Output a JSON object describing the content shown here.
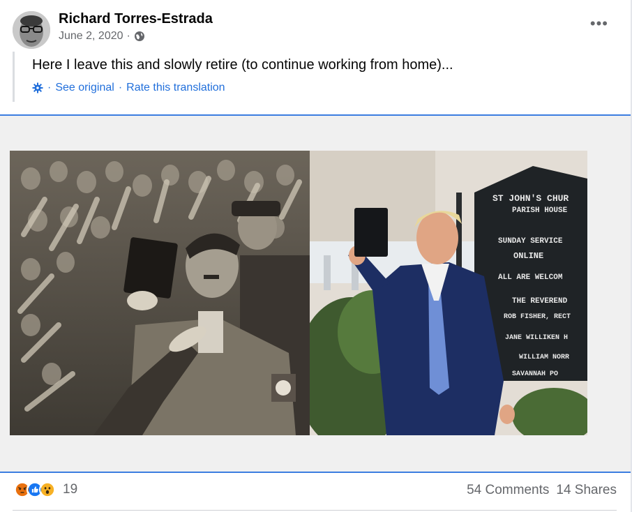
{
  "post": {
    "author": "Richard Torres-Estrada",
    "date": "June 2, 2020",
    "date_separator": "·",
    "privacy_icon": "globe-icon",
    "more_label": "•••",
    "text": "Here I leave this and slowly retire (to continue working from home)...",
    "translation": {
      "icon": "gear-icon",
      "separator": "·",
      "see_original": "See original",
      "rate": "Rate this translation"
    }
  },
  "media": {
    "left_image": "bw-crowd-salute-photo",
    "right_image": "color-photo-man-holding-book",
    "sign_lines": [
      "ST JOHN'S CHUR",
      "PARISH HOUSE",
      "SUNDAY SERVICE",
      "ONLINE",
      "ALL ARE WELCOM",
      "THE REVEREND",
      "ROB FISHER, RECT",
      "JANE WILLIKEN H",
      "WILLIAM NORR",
      "SAVANNAH PO"
    ]
  },
  "footer": {
    "reaction_icons": [
      "angry-icon",
      "like-icon",
      "wow-icon"
    ],
    "reaction_count": "19",
    "comments": "54 Comments",
    "shares": "14 Shares"
  },
  "colors": {
    "link": "#216fdb",
    "secondary": "#65676b",
    "media_border": "#3b7de0",
    "angry": "#e9710f",
    "like": "#1877f2",
    "wow": "#f7b125"
  }
}
